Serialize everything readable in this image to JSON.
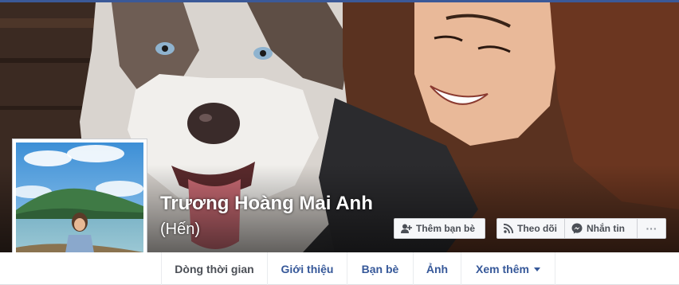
{
  "profile": {
    "name": "Trương Hoàng Mai Anh",
    "alternate_name": "(Hến)"
  },
  "actions": {
    "add_friend": "Thêm bạn bè",
    "follow": "Theo dõi",
    "message": "Nhắn tin",
    "more": "···"
  },
  "tabs": [
    {
      "label": "Dòng thời gian",
      "active": true
    },
    {
      "label": "Giới thiệu"
    },
    {
      "label": "Bạn bè"
    },
    {
      "label": "Ảnh"
    },
    {
      "label": "Xem thêm"
    }
  ],
  "icons": {
    "add_friend": "add-friend-icon",
    "follow": "rss-icon",
    "message": "messenger-icon",
    "more_tab": "caret-down-icon"
  },
  "colors": {
    "brand": "#3b5998",
    "link": "#365899",
    "nav_bg": "#ffffff",
    "page_bg": "#e9ebee"
  }
}
